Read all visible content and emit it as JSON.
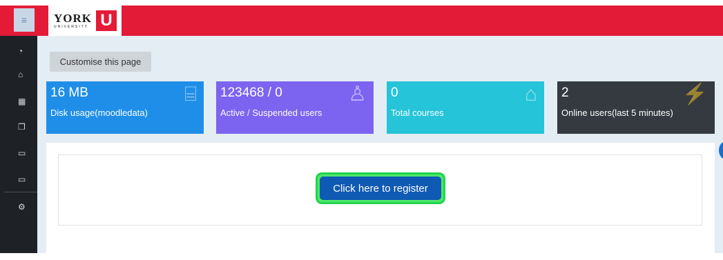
{
  "topbar": {
    "menu_icon": "hamburger-icon",
    "logo": {
      "word": "YORK",
      "sub": "UNIVERSITY",
      "mark": "U"
    }
  },
  "sidebar": {
    "items": [
      {
        "icon": "dashboard-gauge-icon",
        "glyph": "◔"
      },
      {
        "icon": "home-icon",
        "glyph": "⌂"
      },
      {
        "icon": "calendar-icon",
        "glyph": "▦"
      },
      {
        "icon": "files-icon",
        "glyph": "❐"
      },
      {
        "icon": "folder-icon",
        "glyph": "▭"
      },
      {
        "icon": "folder-icon",
        "glyph": "▭"
      },
      {
        "icon": "settings-gear-icon",
        "glyph": "⚙"
      }
    ]
  },
  "main": {
    "customise_label": "Customise this page",
    "cards": [
      {
        "value": "16 MB",
        "label": "Disk usage(moodledata)",
        "icon": "inbox-tray-icon",
        "glyph": "⌸",
        "color": "#1f8ee8"
      },
      {
        "value": "123468 / 0",
        "label": "Active / Suspended users",
        "icon": "users-icon",
        "glyph": "♙",
        "color": "#7c64f0"
      },
      {
        "value": "0",
        "label": "Total courses",
        "icon": "graduation-cap-icon",
        "glyph": "⌂",
        "color": "#26c4d8"
      },
      {
        "value": "2",
        "label": "Online users(last 5 minutes)",
        "icon": "plug-icon",
        "glyph": "⚡",
        "color": "#343a40"
      }
    ],
    "register_label": "Click here to register"
  },
  "colors": {
    "topbar": "#e31b37",
    "sidebar": "#1e2226",
    "background": "#e4edf3",
    "register_button": "#0f5ab3",
    "register_highlight": "#22d34d"
  }
}
